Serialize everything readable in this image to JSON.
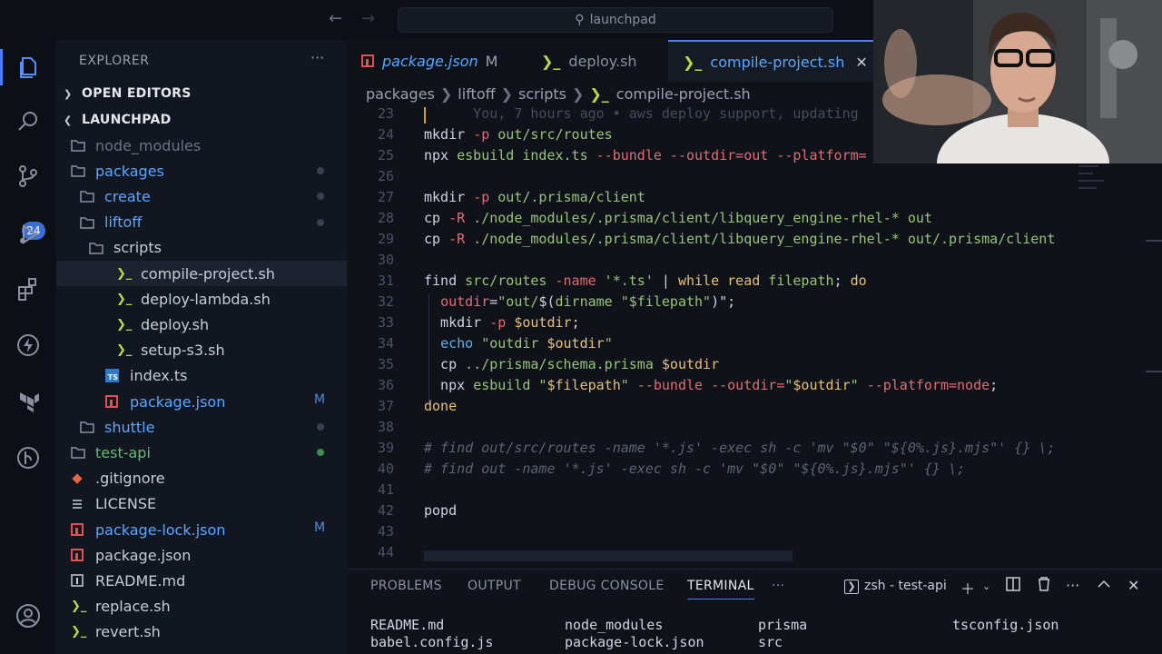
{
  "window": {
    "search_text": "launchpad"
  },
  "activity_bar": {
    "items": [
      "explorer-icon",
      "search-icon",
      "source-control-icon",
      "run-debug-icon",
      "extensions-icon",
      "lightning-icon",
      "terraform-icon",
      "git-graph-icon",
      "account-icon",
      "settings-icon"
    ],
    "source_control_badge": "24"
  },
  "sidebar": {
    "title": "EXPLORER",
    "more": "···",
    "open_editors": "OPEN EDITORS",
    "root": "LAUNCHPAD",
    "tree": [
      {
        "label": "node_modules",
        "kind": "folder",
        "depth": 0,
        "chevron": false,
        "color": "#6b7280"
      },
      {
        "label": "packages",
        "kind": "folder-open",
        "depth": 0,
        "chevron": false,
        "color": "#5aa7ff"
      },
      {
        "label": "create",
        "kind": "folder",
        "depth": 1,
        "chevron": false,
        "color": "#5aa7ff"
      },
      {
        "label": "liftoff",
        "kind": "folder-open",
        "depth": 1,
        "chevron": false,
        "color": "#5aa7ff"
      },
      {
        "label": "scripts",
        "kind": "folder-open",
        "depth": 2,
        "chevron": false,
        "color": "#c8ccd4"
      },
      {
        "label": "compile-project.sh",
        "kind": "shell",
        "depth": 3,
        "color": "#c8ccd4"
      },
      {
        "label": "deploy-lambda.sh",
        "kind": "shell",
        "depth": 3,
        "color": "#c8ccd4"
      },
      {
        "label": "deploy.sh",
        "kind": "shell",
        "depth": 3,
        "color": "#c8ccd4"
      },
      {
        "label": "setup-s3.sh",
        "kind": "shell",
        "depth": 3,
        "color": "#c8ccd4"
      },
      {
        "label": "index.ts",
        "kind": "ts",
        "depth": 2,
        "color": "#c8ccd4"
      },
      {
        "label": "package.json",
        "kind": "npm",
        "depth": 2,
        "color": "#5aa7ff",
        "flag": "M"
      },
      {
        "label": "shuttle",
        "kind": "folder",
        "depth": 1,
        "color": "#5aa7ff"
      },
      {
        "label": "test-api",
        "kind": "folder",
        "depth": 0,
        "color": "#5fbf6c"
      },
      {
        "label": ".gitignore",
        "kind": "git",
        "depth": 0,
        "color": "#c8ccd4"
      },
      {
        "label": "LICENSE",
        "kind": "license",
        "depth": 0,
        "color": "#c8ccd4"
      },
      {
        "label": "package-lock.json",
        "kind": "npm",
        "depth": 0,
        "color": "#5aa7ff",
        "flag": "M"
      },
      {
        "label": "package.json",
        "kind": "npm",
        "depth": 0,
        "color": "#c8ccd4"
      },
      {
        "label": "README.md",
        "kind": "info",
        "depth": 0,
        "color": "#c8ccd4"
      },
      {
        "label": "replace.sh",
        "kind": "shell",
        "depth": 0,
        "color": "#c8ccd4"
      },
      {
        "label": "revert.sh",
        "kind": "shell",
        "depth": 0,
        "color": "#c8ccd4"
      }
    ]
  },
  "tabs": [
    {
      "label": "package.json",
      "flag": "M",
      "icon": "npm-icon"
    },
    {
      "label": "deploy.sh",
      "icon": "shell-icon"
    },
    {
      "label": "compile-project.sh",
      "icon": "shell-icon",
      "active": true
    }
  ],
  "breadcrumb": [
    "packages",
    "liftoff",
    "scripts",
    "compile-project.sh"
  ],
  "editor": {
    "blame": "You, 7 hours ago • aws deploy support, updating",
    "lines": [
      {
        "n": "23",
        "segs": []
      },
      {
        "n": "24",
        "segs": [
          [
            "tx",
            "mkdir "
          ],
          [
            "fl",
            "-p"
          ],
          [
            "st",
            " out/src/routes"
          ]
        ]
      },
      {
        "n": "25",
        "segs": [
          [
            "tx",
            "npx "
          ],
          [
            "st",
            "esbuild index.ts "
          ],
          [
            "fl",
            "--bundle --outdir=out --platform="
          ]
        ]
      },
      {
        "n": "26",
        "segs": []
      },
      {
        "n": "27",
        "segs": [
          [
            "tx",
            "mkdir "
          ],
          [
            "fl",
            "-p"
          ],
          [
            "st",
            " out/.prisma/client"
          ]
        ]
      },
      {
        "n": "28",
        "segs": [
          [
            "tx",
            "cp "
          ],
          [
            "fl",
            "-R"
          ],
          [
            "st",
            " ./node_modules/.prisma/client/libquery_engine-rhel-* out"
          ]
        ]
      },
      {
        "n": "29",
        "segs": [
          [
            "tx",
            "cp "
          ],
          [
            "fl",
            "-R"
          ],
          [
            "st",
            " ./node_modules/.prisma/client/libquery_engine-rhel-* out/.prisma/client"
          ]
        ]
      },
      {
        "n": "30",
        "segs": []
      },
      {
        "n": "31",
        "segs": [
          [
            "tx",
            "find "
          ],
          [
            "st",
            "src/routes "
          ],
          [
            "fl",
            "-name"
          ],
          [
            "st",
            " '*.ts'"
          ],
          [
            "tx",
            " | "
          ],
          [
            "vr",
            "while"
          ],
          [
            "tx",
            " "
          ],
          [
            "vr",
            "read"
          ],
          [
            "st",
            " filepath"
          ],
          [
            "tx",
            "; "
          ],
          [
            "vr",
            "do"
          ]
        ]
      },
      {
        "n": "32",
        "segs": [
          [
            "tx",
            "  "
          ],
          [
            "fl",
            "outdir"
          ],
          [
            "tx",
            "="
          ],
          [
            "st",
            "\"out/"
          ],
          [
            "tx",
            "$("
          ],
          [
            "st",
            "dirname \"$filepath\""
          ],
          [
            "tx",
            ")\";"
          ]
        ]
      },
      {
        "n": "33",
        "segs": [
          [
            "tx",
            "  mkdir "
          ],
          [
            "fl",
            "-p"
          ],
          [
            "vr",
            " $outdir"
          ],
          [
            "tx",
            ";"
          ]
        ]
      },
      {
        "n": "34",
        "segs": [
          [
            "tx",
            "  "
          ],
          [
            "bl",
            "echo"
          ],
          [
            "st",
            " \"outdir "
          ],
          [
            "vr",
            "$outdir"
          ],
          [
            "st",
            "\""
          ]
        ]
      },
      {
        "n": "35",
        "segs": [
          [
            "tx",
            "  cp "
          ],
          [
            "st",
            "../prisma/schema.prisma "
          ],
          [
            "vr",
            "$outdir"
          ]
        ]
      },
      {
        "n": "36",
        "segs": [
          [
            "tx",
            "  npx "
          ],
          [
            "st",
            "esbuild \""
          ],
          [
            "vr",
            "$filepath"
          ],
          [
            "st",
            "\" "
          ],
          [
            "fl",
            "--bundle --outdir="
          ],
          [
            "st",
            "\""
          ],
          [
            "vr",
            "$outdir"
          ],
          [
            "st",
            "\" "
          ],
          [
            "fl",
            "--platform=node"
          ],
          [
            "tx",
            ";"
          ]
        ]
      },
      {
        "n": "37",
        "segs": [
          [
            "vr",
            "done"
          ]
        ]
      },
      {
        "n": "38",
        "segs": []
      },
      {
        "n": "39",
        "segs": [
          [
            "cm",
            "# find out/src/routes -name '*.js' -exec sh -c 'mv \"$0\" \"${0%.js}.mjs\"' {} \\;"
          ]
        ]
      },
      {
        "n": "40",
        "segs": [
          [
            "cm",
            "# find out -name '*.js' -exec sh -c 'mv \"$0\" \"${0%.js}.mjs\"' {} \\;"
          ]
        ]
      },
      {
        "n": "41",
        "segs": []
      },
      {
        "n": "42",
        "segs": [
          [
            "tx",
            "popd"
          ]
        ]
      },
      {
        "n": "43",
        "segs": []
      },
      {
        "n": "44",
        "segs": []
      }
    ]
  },
  "panel": {
    "tabs": [
      "PROBLEMS",
      "OUTPUT",
      "DEBUG CONSOLE",
      "TERMINAL"
    ],
    "active_tab": "TERMINAL",
    "more": "···",
    "shell_label": "zsh - test-api",
    "terminal_rows": [
      [
        "README.md",
        "node_modules",
        "prisma",
        "tsconfig.json"
      ],
      [
        "babel.config.js",
        "package-lock.json",
        "src",
        ""
      ]
    ]
  },
  "colors": {
    "accent": "#4a7dff",
    "modified": "#4e8bd8",
    "string": "#98c379",
    "flag": "#e06c75",
    "keyword": "#e5c07b"
  }
}
